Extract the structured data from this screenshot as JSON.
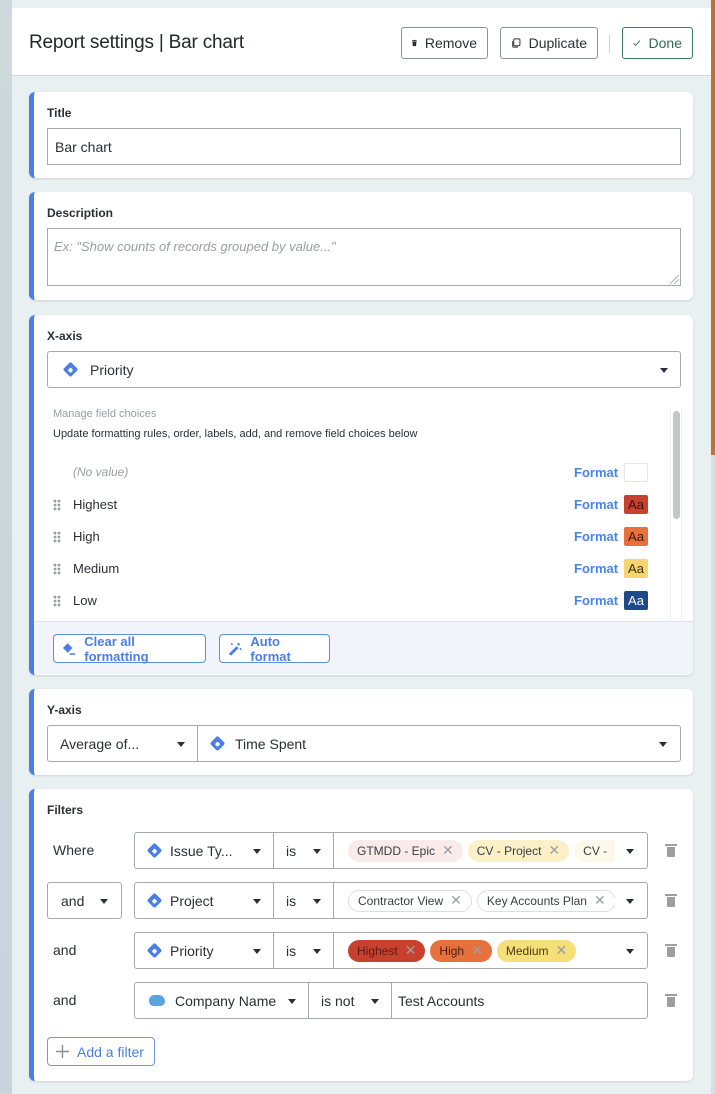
{
  "header": {
    "title": "Report settings | Bar chart",
    "remove_label": "Remove",
    "duplicate_label": "Duplicate",
    "done_label": "Done"
  },
  "title_section": {
    "label": "Title",
    "value": "Bar chart"
  },
  "description_section": {
    "label": "Description",
    "placeholder": "Ex: \"Show counts of records grouped by value...\"",
    "value": ""
  },
  "x_axis": {
    "label": "X-axis",
    "field": "Priority",
    "field_icon": "jira-icon",
    "manage_title": "Manage field choices",
    "manage_desc": "Update formatting rules, order, labels, add, and remove field choices below",
    "format_label": "Format",
    "swatch_text": "Aa",
    "choices": [
      {
        "label": "(No value)",
        "color": "#ffffff",
        "text_color": "#ffffff",
        "draggable": false
      },
      {
        "label": "Highest",
        "color": "#c8412f",
        "text_color": "#3a1410",
        "draggable": true
      },
      {
        "label": "High",
        "color": "#e8703c",
        "text_color": "#3a1a0a",
        "draggable": true
      },
      {
        "label": "Medium",
        "color": "#f6d46f",
        "text_color": "#3a300a",
        "draggable": true
      },
      {
        "label": "Low",
        "color": "#1e4a8a",
        "text_color": "#ffffff",
        "draggable": true
      }
    ],
    "clear_label": "Clear all formatting",
    "auto_label": "Auto format"
  },
  "y_axis": {
    "label": "Y-axis",
    "aggregation": "Average of...",
    "field": "Time Spent",
    "field_icon": "jira-icon"
  },
  "filters": {
    "label": "Filters",
    "add_label": "Add a filter",
    "rows": [
      {
        "conjunction": "Where",
        "conjunction_is_select": false,
        "field": "Issue Ty...",
        "field_icon": "jira-icon",
        "operator": "is",
        "chips": [
          {
            "label": "GTMDD - Epic",
            "bg": "#f9ebea",
            "fg": "#3a3d40"
          },
          {
            "label": "CV - Project",
            "bg": "#fbf0c8",
            "fg": "#3a3d40"
          },
          {
            "label": "CV -",
            "bg": "#fdf9ea",
            "fg": "#3a3d40"
          }
        ]
      },
      {
        "conjunction": "and",
        "conjunction_is_select": true,
        "field": "Project",
        "field_icon": "jira-icon",
        "operator": "is",
        "chips": [
          {
            "label": "Contractor View",
            "bg": "#ffffff",
            "fg": "#3a3d40"
          },
          {
            "label": "Key Accounts Plan",
            "bg": "#ffffff",
            "fg": "#3a3d40"
          }
        ]
      },
      {
        "conjunction": "and",
        "conjunction_is_select": false,
        "field": "Priority",
        "field_icon": "jira-icon",
        "operator": "is",
        "chips": [
          {
            "label": "Highest",
            "bg": "#c8412f",
            "fg": "#5a1a12"
          },
          {
            "label": "High",
            "bg": "#e8703c",
            "fg": "#4a2010"
          },
          {
            "label": "Medium",
            "bg": "#f6df78",
            "fg": "#4a3a10"
          }
        ]
      },
      {
        "conjunction": "and",
        "conjunction_is_select": false,
        "field": "Company Name",
        "field_icon": "salesforce-cloud-icon",
        "operator": "is not",
        "text_value": "Test Accounts"
      }
    ]
  }
}
